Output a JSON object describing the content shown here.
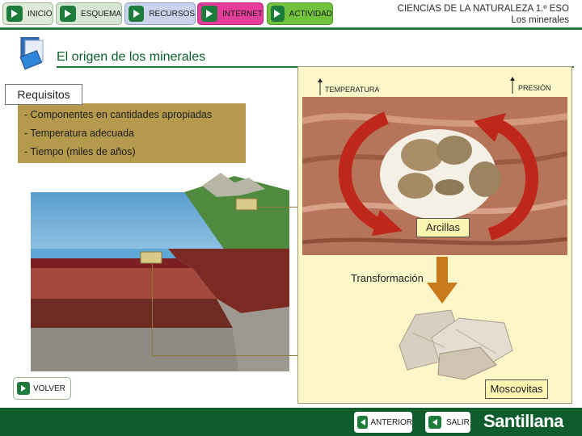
{
  "nav": {
    "items": [
      {
        "label": "INICIO"
      },
      {
        "label": "ESQUEMA"
      },
      {
        "label": "RECURSOS"
      },
      {
        "label": "INTERNET"
      },
      {
        "label": "ACTIVIDAD"
      }
    ]
  },
  "header": {
    "course": "CIENCIAS DE LA NATURALEZA 1.º ESO",
    "unit": "Los minerales"
  },
  "page": {
    "title": "El origen de los minerales"
  },
  "requisitos": {
    "label": "Requisitos",
    "items": [
      "- Componentes en cantidades apropiadas",
      "- Temperatura adecuada",
      "- Tiempo (miles de años)"
    ]
  },
  "diagram": {
    "temperatura": "TEMPERATURA",
    "presion": "PRESIÓN",
    "arcillas": "Arcillas",
    "transformacion": "Transformación",
    "moscovitas": "Moscovitas"
  },
  "buttons": {
    "volver": "VOLVER",
    "anterior": "ANTERIOR",
    "salir": "SALIR"
  },
  "brand": {
    "name": "Santillana"
  },
  "colors": {
    "green_dark": "#0f5c2c",
    "green": "#1d7c3b",
    "panel": "#fcf6c8",
    "requisitos_bg": "#b59a4d",
    "arrow_red": "#c0271b"
  }
}
